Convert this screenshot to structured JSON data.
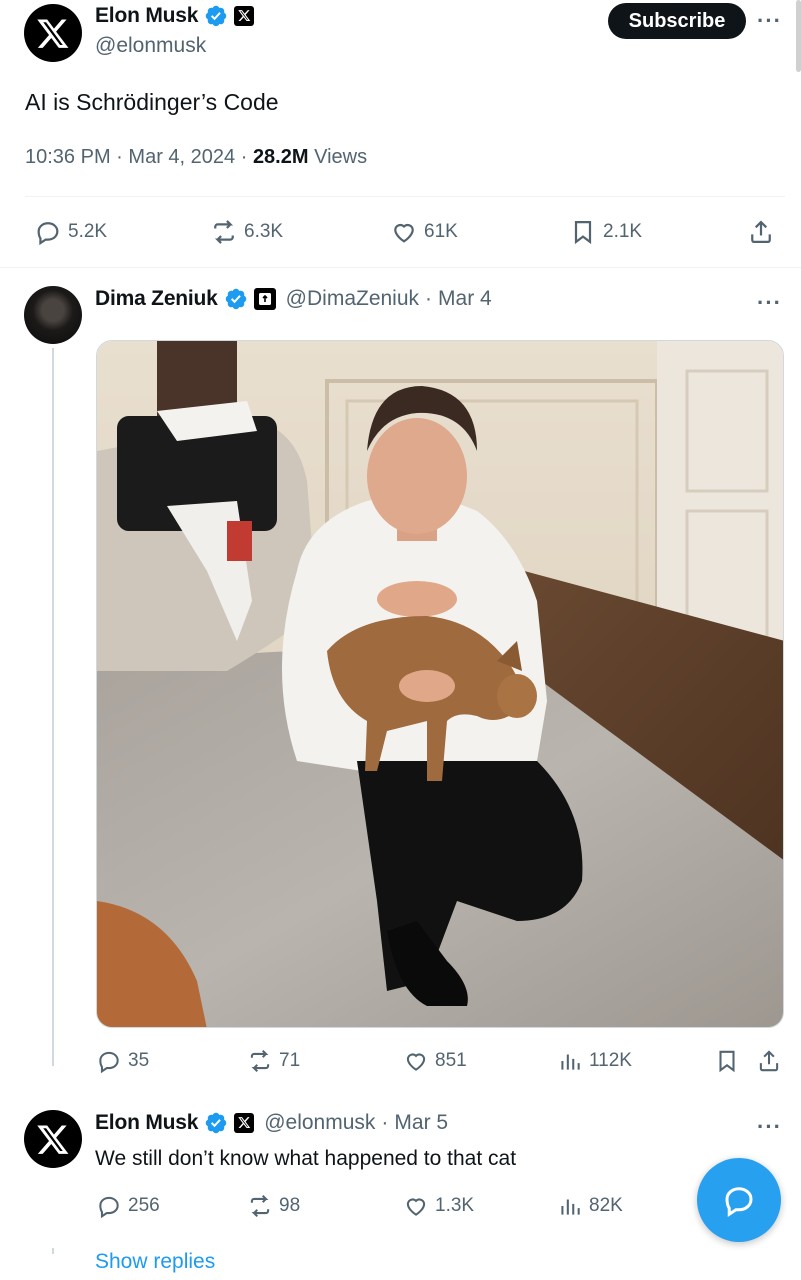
{
  "main_tweet": {
    "author_name": "Elon Musk",
    "author_handle": "@elonmusk",
    "subscribe_label": "Subscribe",
    "text": "AI is Schrödinger’s Code",
    "time": "10:36 PM",
    "date": "Mar 4, 2024",
    "views_count": "28.2M",
    "views_label": "Views",
    "replies": "5.2K",
    "reposts": "6.3K",
    "likes": "61K",
    "bookmarks": "2.1K"
  },
  "reply_1": {
    "author_name": "Dima Zeniuk",
    "author_handle": "@DimaZeniuk",
    "date": "Mar 4",
    "replies": "35",
    "reposts": "71",
    "likes": "851",
    "views": "112K"
  },
  "reply_2": {
    "author_name": "Elon Musk",
    "author_handle": "@elonmusk",
    "date": "Mar 5",
    "text": "We still don’t know what happened to that cat",
    "replies": "256",
    "reposts": "98",
    "likes": "1.3K",
    "views": "82K"
  },
  "show_replies_label": "Show replies",
  "separator": "·",
  "more_label": "···",
  "colors": {
    "accent": "#1d9bf0",
    "text": "#0f1419",
    "muted": "#536471"
  }
}
